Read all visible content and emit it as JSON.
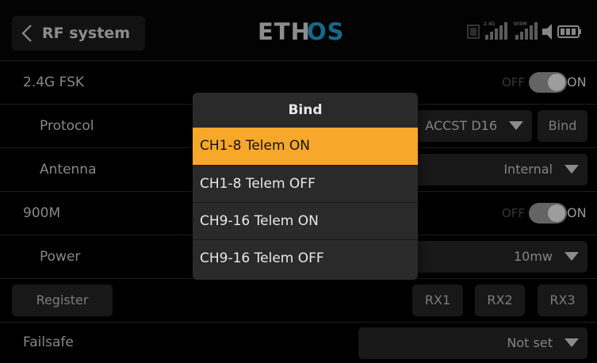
{
  "header": {
    "title": "RF system",
    "logo_text": "ETHOS",
    "status": {
      "rssi_24g_label": "2.4G",
      "rssi_900m_label": "900M"
    }
  },
  "settings": {
    "fsk_24g": {
      "label": "2.4G FSK",
      "off": "OFF",
      "on": "ON"
    },
    "protocol": {
      "label": "Protocol",
      "value": "ACCST D16",
      "bind_label": "Bind"
    },
    "antenna": {
      "label": "Antenna",
      "value": "Internal"
    },
    "m900": {
      "label": "900M",
      "off": "OFF",
      "on": "ON"
    },
    "power": {
      "label": "Power",
      "value": "10mw"
    },
    "register": {
      "label": "Register",
      "rx1": "RX1",
      "rx2": "RX2",
      "rx3": "RX3"
    },
    "failsafe": {
      "label": "Failsafe",
      "value": "Not set"
    }
  },
  "bind_dialog": {
    "title": "Bind",
    "options": [
      "CH1-8 Telem ON",
      "CH1-8 Telem OFF",
      "CH9-16 Telem ON",
      "CH9-16 Telem OFF"
    ],
    "selected_index": 0
  },
  "colors": {
    "accent": "#f7a72a",
    "logo_blue": "#1fa2d8",
    "logo_white": "#d8d8d8"
  }
}
